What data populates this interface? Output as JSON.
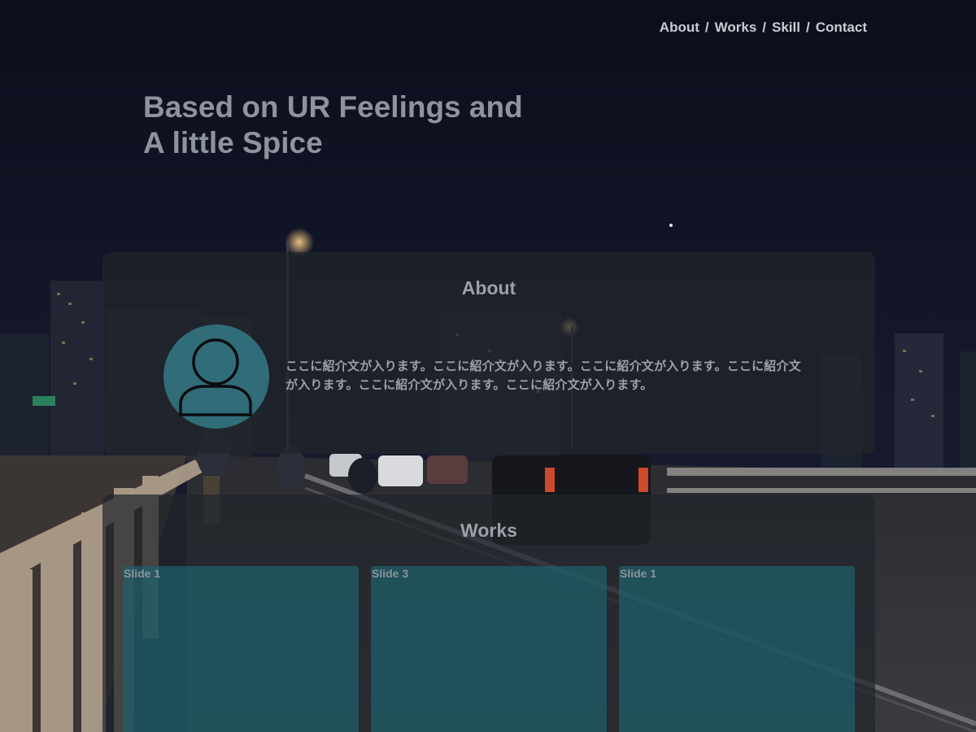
{
  "nav": {
    "items": [
      {
        "label": "About"
      },
      {
        "label": "Works"
      },
      {
        "label": "Skill"
      },
      {
        "label": "Contact"
      }
    ],
    "separator": "/"
  },
  "hero": {
    "line1": "Based on UR Feelings and",
    "line2": "A little Spice"
  },
  "about": {
    "title": "About",
    "avatar_icon": "user-icon",
    "text": "ここに紹介文が入ります。ここに紹介文が入ります。ここに紹介文が入ります。ここに紹介文が入ります。ここに紹介文が入ります。ここに紹介文が入ります。"
  },
  "works": {
    "title": "Works",
    "slides": [
      {
        "label": "Slide 1"
      },
      {
        "label": "Slide 3"
      },
      {
        "label": "Slide 1"
      }
    ]
  },
  "colors": {
    "panel": "#21262b",
    "avatar": "#347a86",
    "slide": "#1f5f6c",
    "text": "#9aa0a8"
  }
}
